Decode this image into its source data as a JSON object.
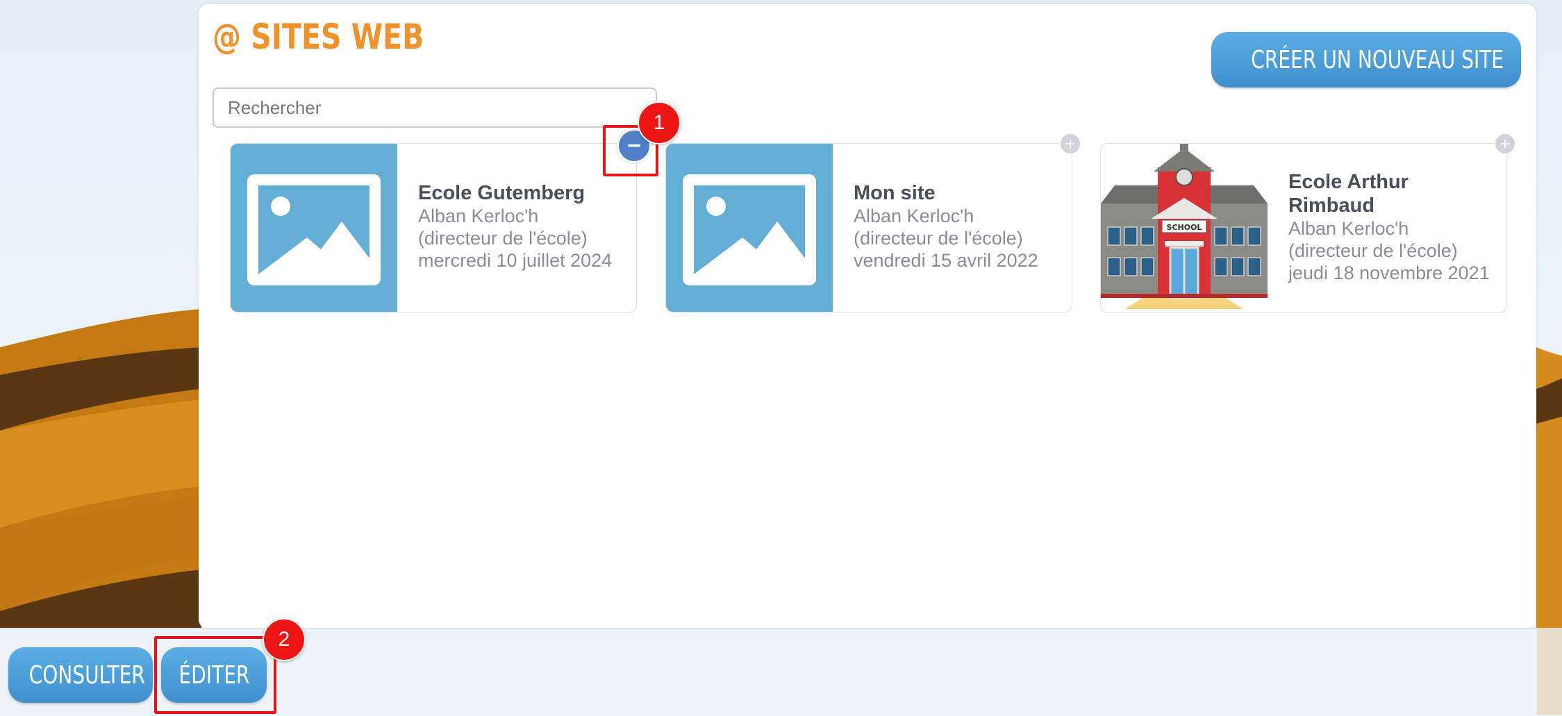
{
  "header": {
    "title": "@ SITES WEB",
    "create_label": "CRÉER UN NOUVEAU SITE"
  },
  "search": {
    "placeholder": "Rechercher",
    "value": ""
  },
  "sites": [
    {
      "name": "Ecole Gutemberg",
      "author": "Alban Kerloc'h",
      "role": "(directeur de l'école)",
      "date": "mercredi 10 juillet 2024",
      "thumbnail": "placeholder-image-icon",
      "toggle": "−",
      "toggle_icon": "minus-icon"
    },
    {
      "name": "Mon site",
      "author": "Alban Kerloc'h",
      "role": "(directeur de l'école)",
      "date": "vendredi 15 avril 2022",
      "thumbnail": "placeholder-image-icon",
      "toggle": "+",
      "toggle_icon": "plus-icon"
    },
    {
      "name": "Ecole Arthur Rimbaud",
      "author": "Alban Kerloc'h",
      "role": "(directeur de l'école)",
      "date": "jeudi 18 novembre 2021",
      "thumbnail": "school-building-image",
      "thumbnail_sign": "SCHOOL",
      "toggle": "+",
      "toggle_icon": "plus-icon"
    }
  ],
  "annotations": [
    {
      "label": "1",
      "color": "#e5151a"
    },
    {
      "label": "2",
      "color": "#e5151a"
    }
  ],
  "bottom_bar": {
    "consult_label": "CONSULTER",
    "edit_label": "ÉDITER"
  },
  "colors": {
    "accent_orange": "#f0922a",
    "button_blue": "#4a9ed9",
    "thumbnail_blue": "#64aed6",
    "highlight_red": "#e5151a"
  }
}
